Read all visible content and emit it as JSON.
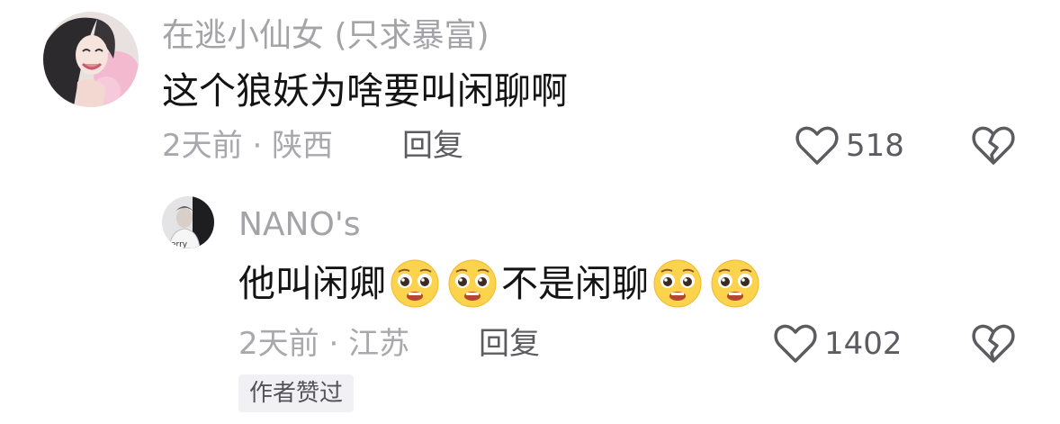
{
  "comments": [
    {
      "username": "在逃小仙女 (只求暴富)",
      "text": "这个狼妖为啥要叫闲聊啊",
      "time": "2天前",
      "separator": "·",
      "location": "陕西",
      "reply_label": "回复",
      "likes": "518"
    }
  ],
  "replies": [
    {
      "username": "NANO's",
      "text_part1": "他叫闲卿",
      "text_part2": "不是闲聊",
      "emoji_name": "pleading-face-emoji",
      "time": "2天前",
      "separator": "·",
      "location": "江苏",
      "reply_label": "回复",
      "likes": "1402",
      "badge": "作者赞过"
    }
  ],
  "colors": {
    "username": "#a3a3a8",
    "text": "#141414",
    "meta": "#a8a8ad",
    "action": "#5c5c60",
    "badge_bg": "#f1f1f3"
  },
  "icons": [
    "heart-outline-icon",
    "broken-heart-icon"
  ]
}
